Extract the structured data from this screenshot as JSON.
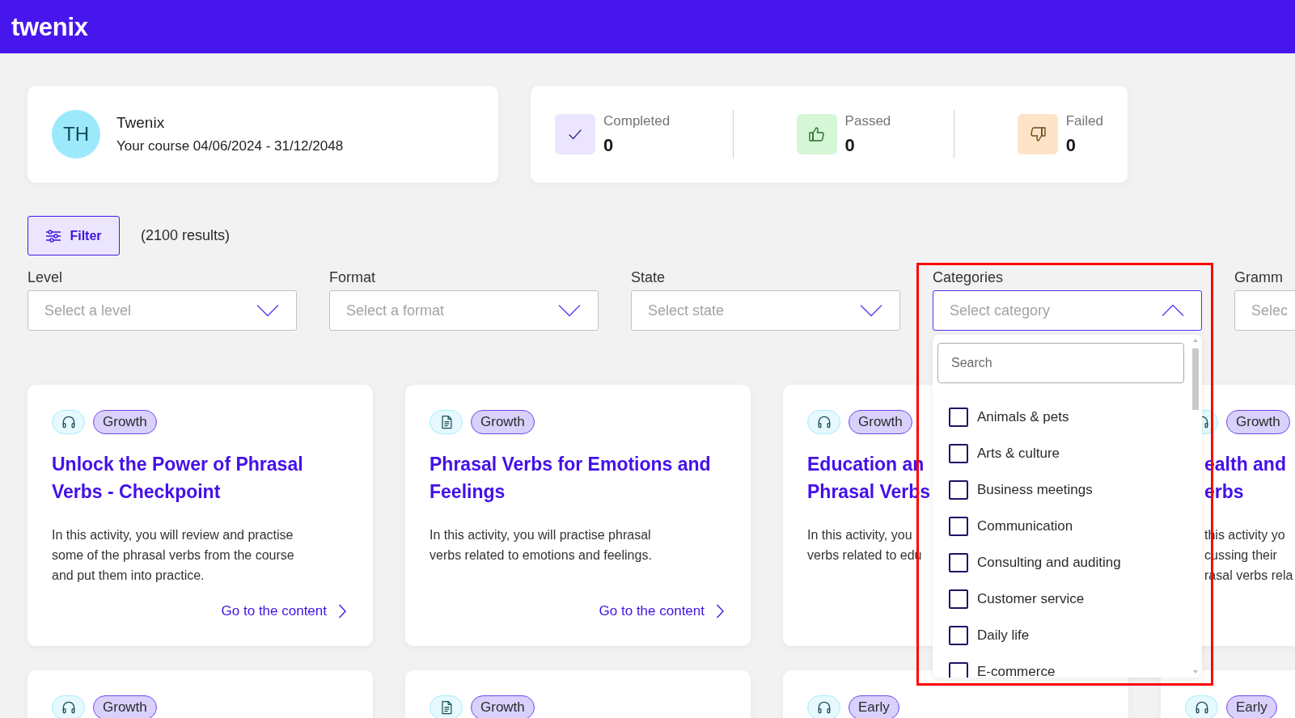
{
  "header": {
    "logo": "twenix"
  },
  "profile": {
    "initials": "TH",
    "name": "Twenix",
    "course": "Your course 04/06/2024 - 31/12/2048"
  },
  "stats": [
    {
      "kind": "completed",
      "label": "Completed",
      "value": "0"
    },
    {
      "kind": "passed",
      "label": "Passed",
      "value": "0"
    },
    {
      "kind": "failed",
      "label": "Failed",
      "value": "0"
    }
  ],
  "toolbar": {
    "filter_button": "Filter",
    "results": "(2100 results)"
  },
  "filters": [
    {
      "label": "Level",
      "placeholder": "Select a level",
      "expanded": false,
      "highlighted": false
    },
    {
      "label": "Format",
      "placeholder": "Select a format",
      "expanded": false,
      "highlighted": false
    },
    {
      "label": "State",
      "placeholder": "Select state",
      "expanded": false,
      "highlighted": false
    },
    {
      "label": "Categories",
      "placeholder": "Select category",
      "expanded": true,
      "highlighted": true,
      "search_placeholder": "Search",
      "options": [
        {
          "label": "Animals & pets",
          "checked": false
        },
        {
          "label": "Arts & culture",
          "checked": false
        },
        {
          "label": "Business meetings",
          "checked": false
        },
        {
          "label": "Communication",
          "checked": false
        },
        {
          "label": "Consulting and auditing",
          "checked": false
        },
        {
          "label": "Customer service",
          "checked": false
        },
        {
          "label": "Daily life",
          "checked": false
        },
        {
          "label": "E-commerce",
          "checked": false
        }
      ]
    },
    {
      "label": "Gramm",
      "placeholder": "Selec",
      "expanded": false,
      "highlighted": false
    }
  ],
  "cards": [
    {
      "kind": "audio",
      "tag": "Growth",
      "title_lines": [
        "Unlock the Power of Phrasal",
        "Verbs - Checkpoint"
      ],
      "description_lines": [
        "In this activity, you will review and practise",
        "some of the phrasal verbs from the course",
        "and put them into practice."
      ],
      "link": "Go to the content"
    },
    {
      "kind": "document",
      "tag": "Growth",
      "title_lines": [
        "Phrasal Verbs for Emotions and",
        "Feelings"
      ],
      "description_lines": [
        "In this activity, you will practise phrasal",
        "verbs related to emotions and feelings."
      ],
      "link": "Go to the content"
    },
    {
      "kind": "audio",
      "tag": "Growth",
      "title_lines": [
        "Education an",
        "Phrasal Verbs"
      ],
      "description_lines": [
        "In this activity, you",
        "verbs related to edu"
      ]
    },
    {
      "kind": "audio",
      "tag": "Growth",
      "title_lines": [
        "ealth and",
        "erbs"
      ],
      "description_lines": [
        "this activity yo",
        "cussing their",
        "rasal verbs rela"
      ]
    },
    {
      "kind": "audio",
      "tag": "Growth"
    },
    {
      "kind": "document",
      "tag": "Growth"
    },
    {
      "kind": "audio",
      "tag": "Early"
    },
    {
      "kind": "audio",
      "tag": "Early"
    }
  ]
}
